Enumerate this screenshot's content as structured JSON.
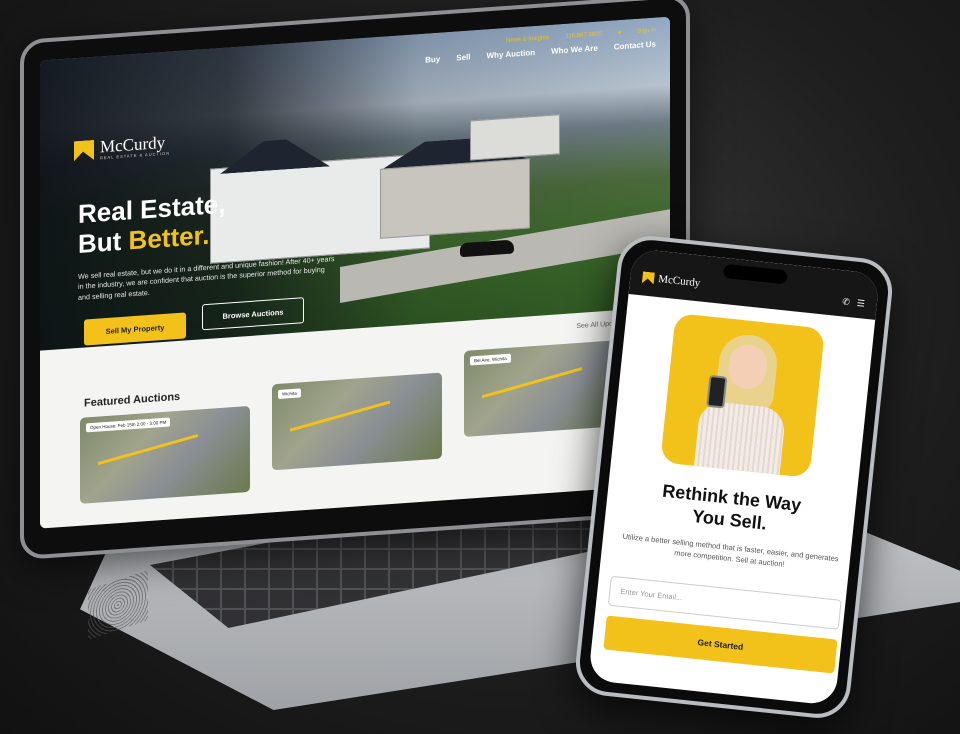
{
  "laptop": {
    "nav_top": {
      "link": "News & Insights",
      "phone": "316.867.3600",
      "account": "Sign In"
    },
    "nav_main": [
      "Buy",
      "Sell",
      "Why Auction",
      "Who We Are",
      "Contact Us"
    ],
    "logo": {
      "name": "McCurdy",
      "tagline": "REAL ESTATE & AUCTION"
    },
    "headline_line1": "Real Estate,",
    "headline_line2_a": "But ",
    "headline_line2_b": "Better.",
    "description": "We sell real estate, but we do it in a different and unique fashion! After 40+ years in the industry, we are confident that auction is the superior method for buying and selling real estate.",
    "primary_button": "Sell My Property",
    "secondary_button": "Browse Auctions",
    "see_all": "See All Upcoming Auctions",
    "featured_title": "Featured Auctions",
    "cards": [
      {
        "tag": "Open House: Feb 15th 2:00 - 3:00 PM"
      },
      {
        "tag": "Wichita"
      },
      {
        "tag": "Bel Aire, Wichita"
      }
    ]
  },
  "phone": {
    "logo": "McCurdy",
    "title_line1": "Rethink the Way",
    "title_line2": "You Sell.",
    "subtitle": "Utilize a better selling method that is faster, easier, and generates more competition. Sell at auction!",
    "email_placeholder": "Enter Your Email...",
    "cta": "Get Started"
  },
  "colors": {
    "accent": "#f2c21b",
    "dark": "#161616"
  }
}
